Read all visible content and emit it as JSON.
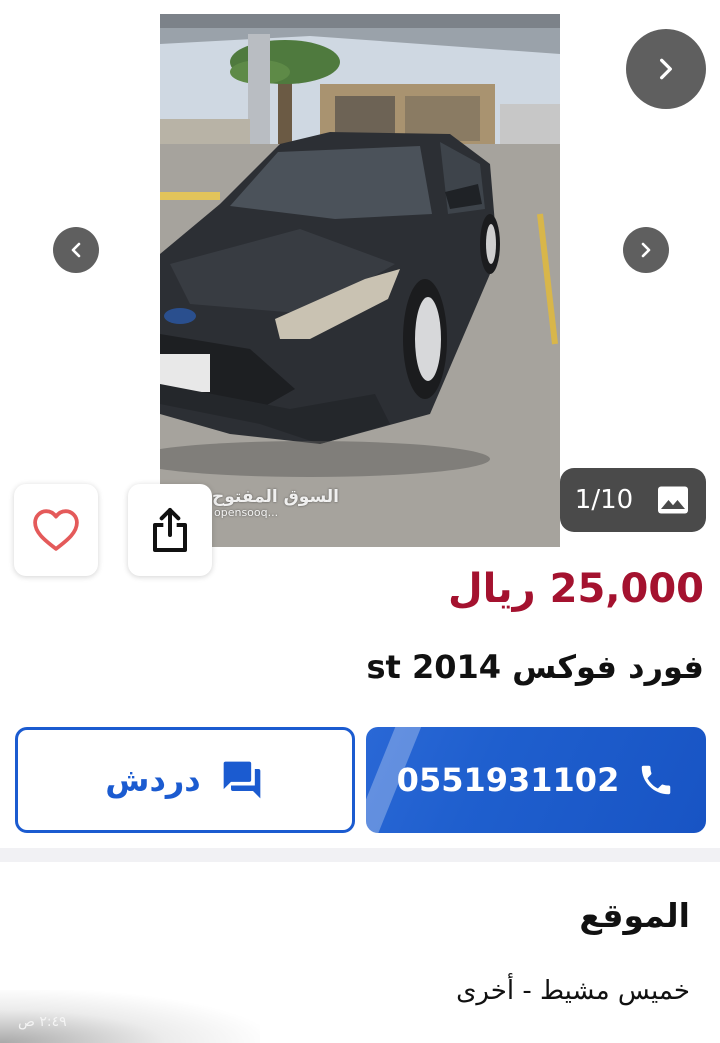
{
  "gallery": {
    "counter": "1/10",
    "counter_icon": "image-icon",
    "watermark_ar": "السوق المفتوح",
    "watermark_en": "opensooq..."
  },
  "listing": {
    "price": "25,000 ريال",
    "title": "فورد فوكس st 2014",
    "price_color": "#a4122f"
  },
  "actions": {
    "call_label": "0551931102",
    "chat_label": "دردش",
    "accent_color": "#1b5bd0"
  },
  "location": {
    "heading": "الموقع",
    "value": "خميس مشيط - أخرى"
  },
  "status": {
    "time": "٢:٤٩ ص"
  }
}
